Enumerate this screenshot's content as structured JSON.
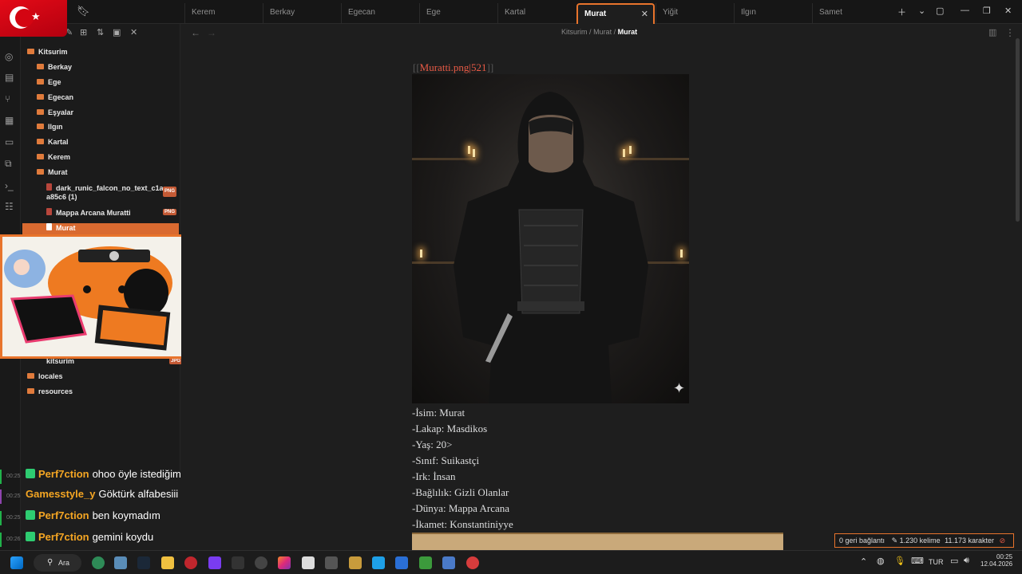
{
  "tabs": [
    {
      "label": "Kerem",
      "active": false
    },
    {
      "label": "Berkay",
      "active": false
    },
    {
      "label": "Egecan",
      "active": false
    },
    {
      "label": "Ege",
      "active": false
    },
    {
      "label": "Kartal",
      "active": false
    },
    {
      "label": "Murat",
      "active": true
    },
    {
      "label": "Yiğit",
      "active": false
    },
    {
      "label": "Ilgın",
      "active": false
    },
    {
      "label": "Samet",
      "active": false
    }
  ],
  "breadcrumb": {
    "root": "Kitsurim",
    "folder": "Murat",
    "sep": "/",
    "current": "Murat"
  },
  "sidebar": {
    "root": "Kitsurim",
    "folders": [
      "Berkay",
      "Ege",
      "Egecan",
      "Eşyalar",
      "Ilgın",
      "Kartal",
      "Kerem",
      "Murat"
    ],
    "files": [
      {
        "name": "dark_runic_falcon_no_text_c1a",
        "name2": "a85c6 (1)",
        "badge": "PNG"
      },
      {
        "name": "Mappa Arcana Muratti",
        "badge": "PNG"
      },
      {
        "name": "Murat",
        "active": true
      }
    ],
    "after_overlay": {
      "name": "kitsurim",
      "badge": "JPG"
    },
    "bottom_folders": [
      "locales",
      "resources"
    ]
  },
  "editor": {
    "embed_open": "[[",
    "embed_text": "Muratti.png|521",
    "embed_close": "]]",
    "lines": [
      "-İsim: Murat",
      "-Lakap: Masdikos",
      "-Yaş: 20>",
      "-Sınıf: Suikastçi",
      "-Irk: İnsan",
      "-Bağlılık: Gizli Olanlar",
      "-Dünya: Mappa Arcana",
      "-İkamet: Konstantiniyye"
    ]
  },
  "status": {
    "backlinks": "0 geri bağlantı",
    "words": "1.230 kelime",
    "chars": "11.173 karakter"
  },
  "chat": [
    {
      "time": "00:25",
      "user": "Perf7ction",
      "user_color": "#f5a623",
      "message": "ohoo öyle istediğimiz şehri alma varmı",
      "sub": true
    },
    {
      "time": "00:25",
      "user": "Gamesstyle_y",
      "user_color": "#f5a623",
      "message": "Göktürk alfabesiii",
      "sub": false
    },
    {
      "time": "00:25",
      "user": "Perf7ction",
      "user_color": "#f5a623",
      "message": "ben koymadım",
      "sub": true
    },
    {
      "time": "00:26",
      "user": "Perf7ction",
      "user_color": "#f5a623",
      "message": "gemini koydu",
      "sub": true
    }
  ],
  "taskbar": {
    "search": "Ara",
    "lang": "TUR",
    "time": "00:25",
    "date": "12.04.2026"
  },
  "colors": {
    "accent": "#e8742c",
    "folder": "#e07b3c",
    "link": "#e85a45"
  }
}
